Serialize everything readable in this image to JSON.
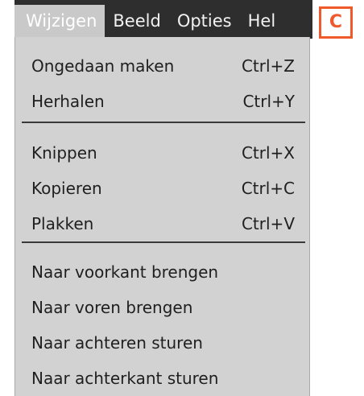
{
  "menubar": {
    "items": [
      {
        "label": "Wijzigen"
      },
      {
        "label": "Beeld"
      },
      {
        "label": "Opties"
      },
      {
        "label": "Hel"
      }
    ]
  },
  "menu": {
    "items": [
      {
        "label": "Ongedaan maken",
        "shortcut": "Ctrl+Z"
      },
      {
        "label": "Herhalen",
        "shortcut": "Ctrl+Y"
      },
      {
        "label": "Knippen",
        "shortcut": "Ctrl+X"
      },
      {
        "label": "Kopieren",
        "shortcut": "Ctrl+C"
      },
      {
        "label": "Plakken",
        "shortcut": "Ctrl+V"
      },
      {
        "label": "Naar voorkant brengen"
      },
      {
        "label": "Naar voren brengen"
      },
      {
        "label": "Naar achteren sturen"
      },
      {
        "label": "Naar achterkant sturen"
      }
    ]
  },
  "badge": {
    "text": "C"
  },
  "colors": {
    "menubar_bg": "#2e2e2e",
    "menu_bg": "#d2d2d2",
    "badge": "#ee5a2c"
  }
}
